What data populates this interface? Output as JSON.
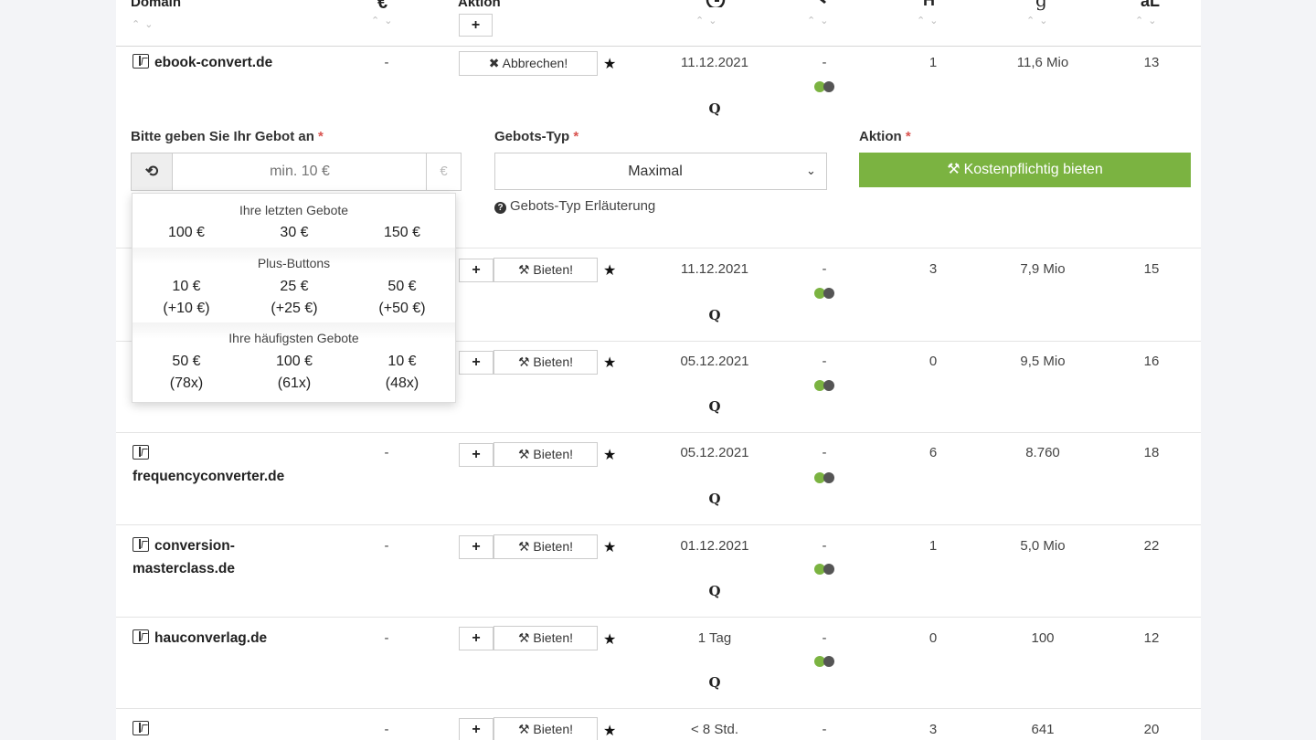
{
  "header": {
    "domain_label": "Domain",
    "price_icon": "€",
    "action_label": "Aktion",
    "add_label": "+",
    "time_icon": "clock-icon",
    "auction_icon": "gavel-icon",
    "h_icon": "H",
    "google_icon": "g",
    "al_icon": "aL"
  },
  "rows": [
    {
      "domain": "ebook-convert.de",
      "price": "-",
      "date": "11.12.2021",
      "bids": "-",
      "col_count": "1",
      "volume": "11,6 Mio",
      "al": "13",
      "action": "✖ Abbrechen!"
    },
    {
      "domain": "",
      "price": "-",
      "date": "11.12.2021",
      "bids": "-",
      "col_count": "3",
      "volume": "7,9 Mio",
      "al": "15",
      "action": "Bieten!"
    },
    {
      "domain": "",
      "price": "-",
      "date": "05.12.2021",
      "bids": "-",
      "col_count": "0",
      "volume": "9,5 Mio",
      "al": "16",
      "action": "Bieten!"
    },
    {
      "domain": "frequencyconverter.de",
      "price": "-",
      "date": "05.12.2021",
      "bids": "-",
      "col_count": "6",
      "volume": "8.760",
      "al": "18",
      "action": "Bieten!"
    },
    {
      "domain": "conversion-masterclass.de",
      "domain_line1": "conversion-",
      "domain_line2": "masterclass.de",
      "price": "-",
      "date": "01.12.2021",
      "bids": "-",
      "col_count": "1",
      "volume": "5,0 Mio",
      "al": "22",
      "action": "Bieten!"
    },
    {
      "domain": "hauconverlag.de",
      "price": "-",
      "date": "1 Tag",
      "bids": "-",
      "col_count": "0",
      "volume": "100",
      "al": "12",
      "action": "Bieten!"
    },
    {
      "domain": "",
      "price": "-",
      "date": "< 8 Std.",
      "bids": "-",
      "col_count": "3",
      "volume": "641",
      "al": "20",
      "action": "Bieten!"
    }
  ],
  "q_label": "Q",
  "star": "★",
  "bid_form": {
    "amount_label": "Bitte geben Sie Ihr Gebot an",
    "required": "*",
    "amount_placeholder": "min. 10 €",
    "currency": "€",
    "type_label": "Gebots-Typ",
    "type_value": "Maximal",
    "type_help": "Gebots-Typ Erläuterung",
    "action_label": "Aktion",
    "submit_label": "Kostenpflichtig bieten",
    "submit_color": "#7bb341"
  },
  "dropdown": {
    "last_title": "Ihre letzten Gebote",
    "last": [
      "100 €",
      "30 €",
      "150 €"
    ],
    "plus_title": "Plus-Buttons",
    "plus": [
      {
        "value": "10 €",
        "sub": "(+10 €)"
      },
      {
        "value": "25 €",
        "sub": "(+25 €)"
      },
      {
        "value": "50 €",
        "sub": "(+50 €)"
      }
    ],
    "freq_title": "Ihre häufigsten Gebote",
    "freq": [
      {
        "value": "50 €",
        "sub": "(78x)"
      },
      {
        "value": "100 €",
        "sub": "(61x)"
      },
      {
        "value": "10 €",
        "sub": "(48x)"
      }
    ]
  }
}
